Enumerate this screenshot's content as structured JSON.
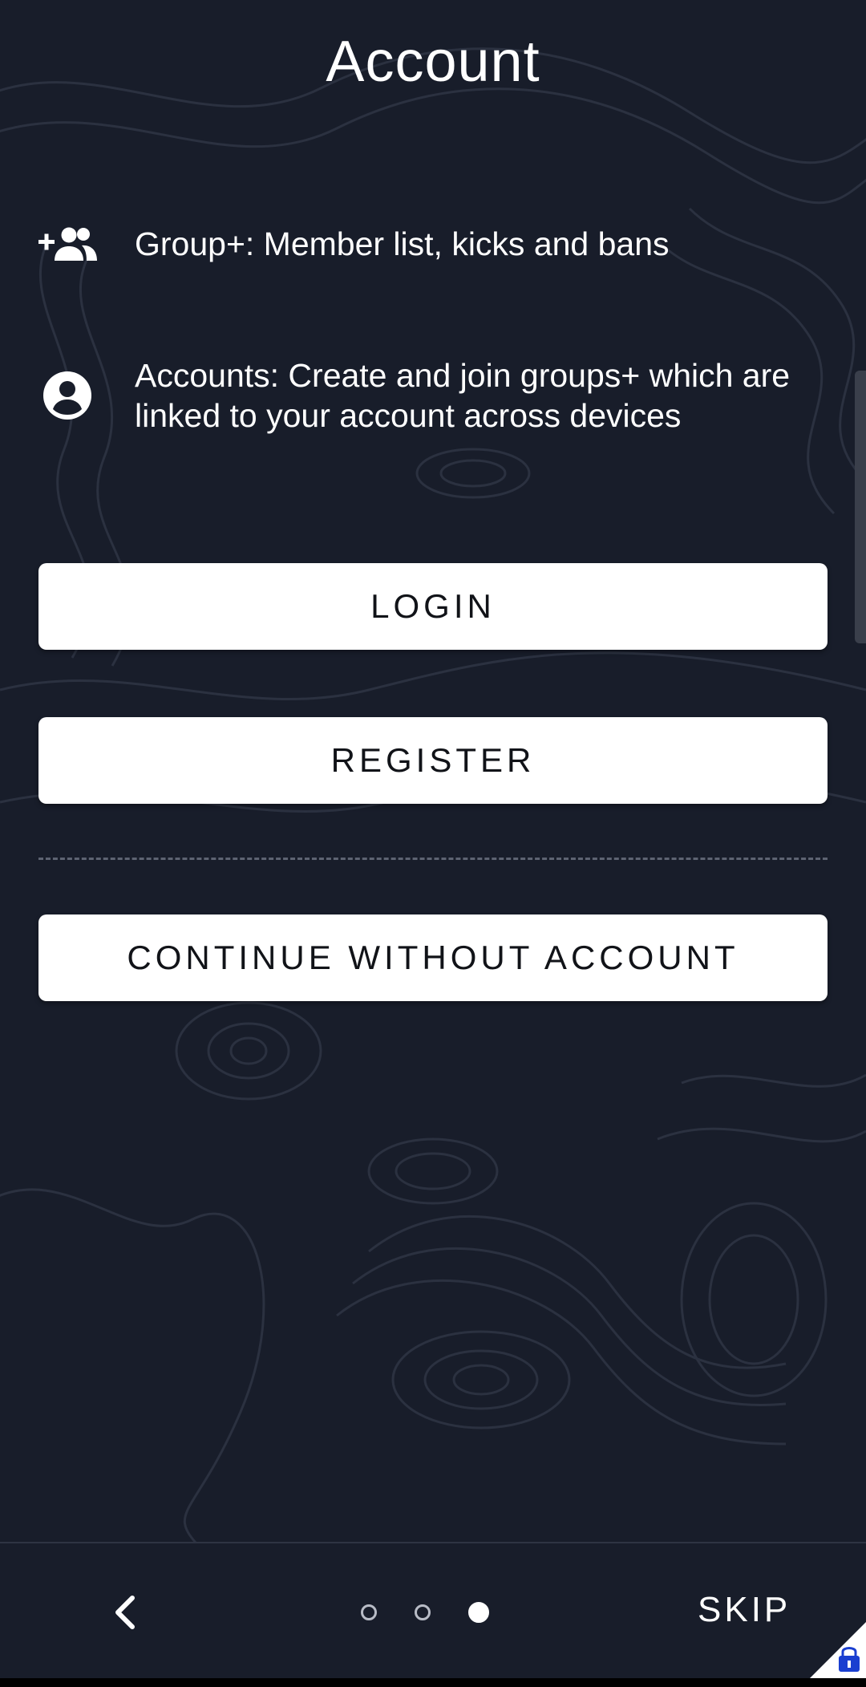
{
  "header": {
    "title": "Account"
  },
  "features": [
    {
      "icon": "group-add-icon",
      "text": "Group+: Member list, kicks and bans"
    },
    {
      "icon": "account-circle-icon",
      "text": "Accounts: Create and join groups+ which are linked to your account across devices"
    }
  ],
  "buttons": {
    "login": "LOGIN",
    "register": "REGISTER",
    "continue": "CONTINUE WITHOUT ACCOUNT"
  },
  "footer": {
    "back_icon": "chevron-left-icon",
    "pager": {
      "total": 3,
      "current": 3
    },
    "skip": "SKIP"
  },
  "colors": {
    "background": "#181d2a",
    "button_bg": "#ffffff",
    "button_text": "#111318",
    "badge": "#1a3fd0"
  }
}
